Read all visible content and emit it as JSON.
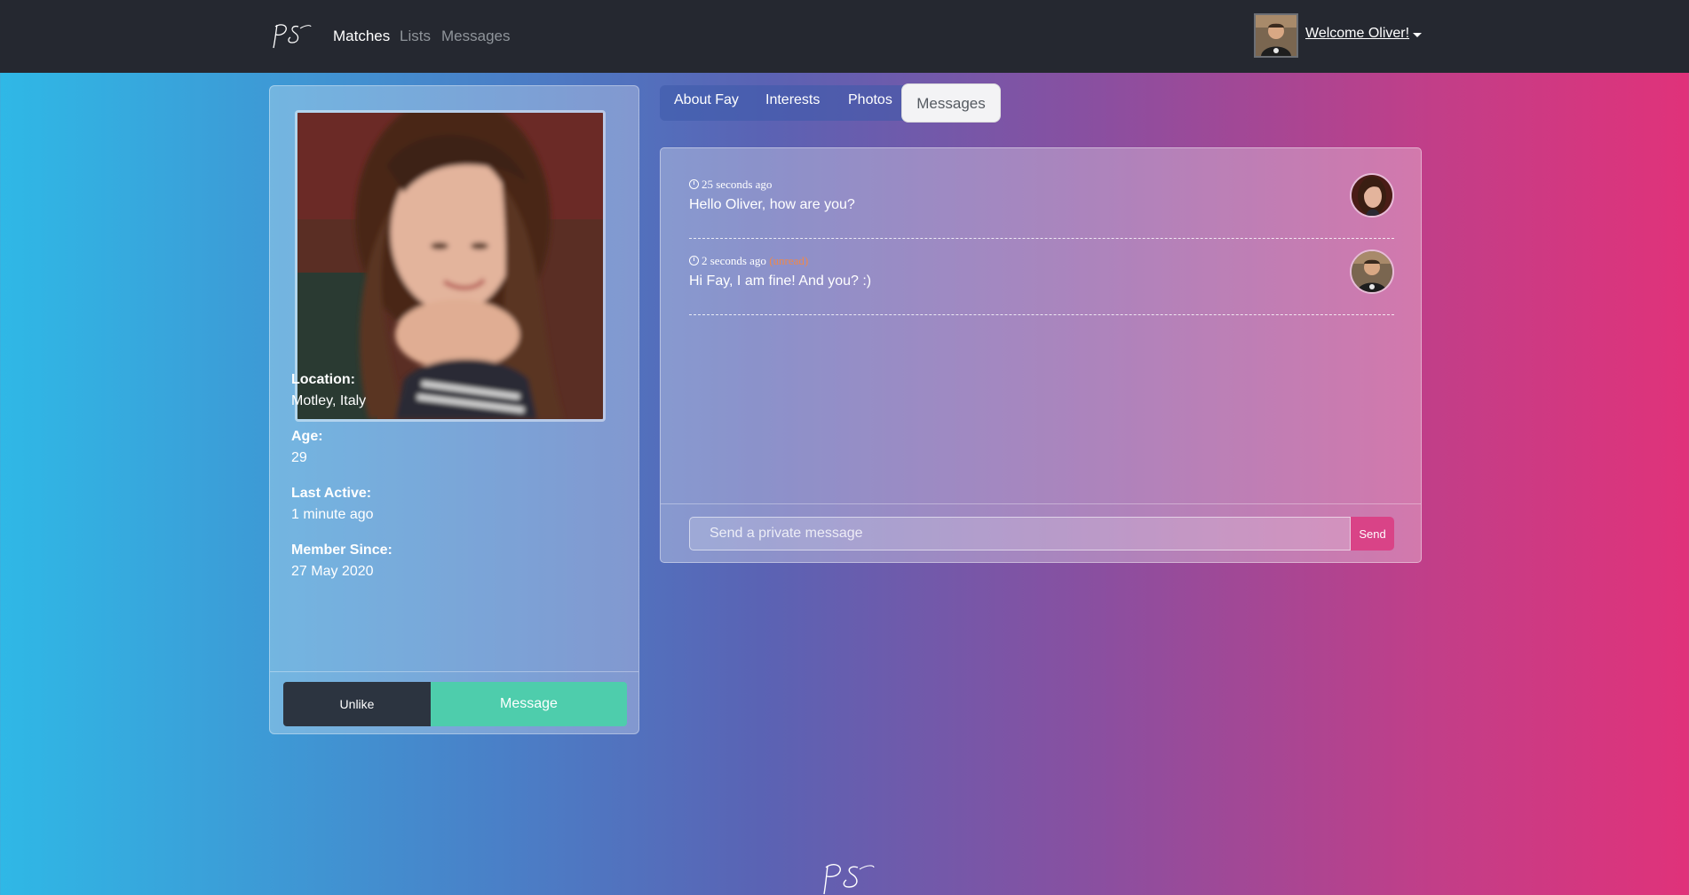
{
  "nav": {
    "links": [
      "Matches",
      "Lists",
      "Messages"
    ],
    "welcome": "Welcome Oliver!"
  },
  "profile": {
    "fields": [
      {
        "label": "Location:",
        "value": "Motley, Italy"
      },
      {
        "label": "Age:",
        "value": "29"
      },
      {
        "label": "Last Active:",
        "value": "1 minute ago"
      },
      {
        "label": "Member Since:",
        "value": "27 May 2020"
      }
    ],
    "buttons": {
      "unlike": "Unlike",
      "message": "Message"
    }
  },
  "tabs": [
    "About Fay",
    "Interests",
    "Photos",
    "Messages"
  ],
  "messages": [
    {
      "time": "25 seconds ago",
      "status": "",
      "text": "Hello Oliver, how are you?"
    },
    {
      "time": "2 seconds ago",
      "status": "(unread)",
      "text": "Hi Fay, I am fine! And you? :)"
    }
  ],
  "composer": {
    "placeholder": "Send a private message",
    "send": "Send"
  },
  "colors": {
    "accent_pink": "#d94387",
    "accent_teal": "#4ecdac",
    "navbar": "#252830"
  }
}
